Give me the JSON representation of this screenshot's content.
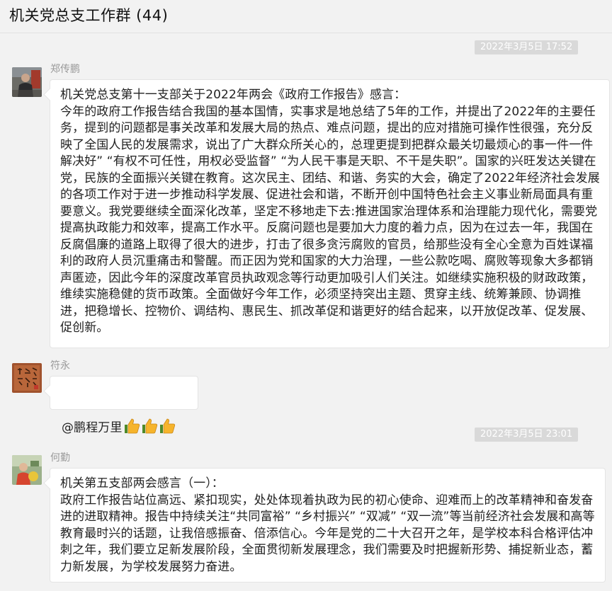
{
  "window": {
    "title": "机关党总支工作群 (44)"
  },
  "messages": [
    {
      "timestamp": "2022年3月5日 17:52",
      "sender": "郑传鹏",
      "text": "机关党总支第十一支部关于2022年两会《政府工作报告》感言：\n今年的政府工作报告结合我国的基本国情，实事求是地总结了5年的工作，并提出了2022年的主要任务，提到的问题都是事关改革和发展大局的热点、难点问题，提出的应对措施可操作性很强，充分反映了全国人民的发展需求，说出了广大群众所关心的，总理更提到把群众最关切最烦心的事一件一件解决好” “有权不可任性，用权必受监督” “为人民干事是天职、不干是失职”。国家的兴旺发达关键在党，民族的全面振兴关键在教育。这次民主、团结、和谐、务实的大会，确定了2022年经济社会发展的各项工作对于进一步推动科学发展、促进社会和谐，不断开创中国特色社会主义事业新局面具有重要意义。我党要继续全面深化改革，坚定不移地走下去:推进国家治理体系和治理能力现代化，需要党提高执政能力和效率，提高工作水平。反腐问题也是要加大力度的着力点，因为在过去一年，我国在反腐倡廉的道路上取得了很大的进步，打击了很多贪污腐败的官员，给那些没有全心全意为百姓谋福利的政府人员沉重痛击和警醒。而正因为党和国家的大力治理，一些公款吃喝、腐败等现象大多都销声匿迹，因此今年的深度改革官员执政观念等行动更加吸引人们关注。如继续实施积极的财政政策，维续实施稳健的货币政策。全面做好今年工作，必须坚持突出主题、贯穿主线、统筹兼顾、协调推进，把稳增长、控物价、调结构、惠民生、抓改革促和谐更好的结合起来，以开放促改革、促发展、促创新。"
    },
    {
      "sender": "符永",
      "text": "@鹏程万里",
      "emoji": "thumbs-up-icon"
    },
    {
      "timestamp": "2022年3月5日 23:01",
      "sender": "何勤",
      "text": "机关第五支部两会感言（一）：\n政府工作报告站位高远、紧扣现实，处处体现着执政为民的初心使命、迎难而上的改革精神和奋发奋进的进取精神。报告中持续关注“共同富裕” “乡村振兴” “双减” “双一流”等当前经济社会发展和高等教育最时兴的话题，让我倍感振奋、倍添信心。今年是党的二十大召开之年，是学校本科合格评估冲刺之年，我们要立足新发展阶段，全面贯彻新发展理念，我们需要及时把握新形势、捕捉新业态，蓄力新发展，为学校发展努力奋进。"
    }
  ]
}
